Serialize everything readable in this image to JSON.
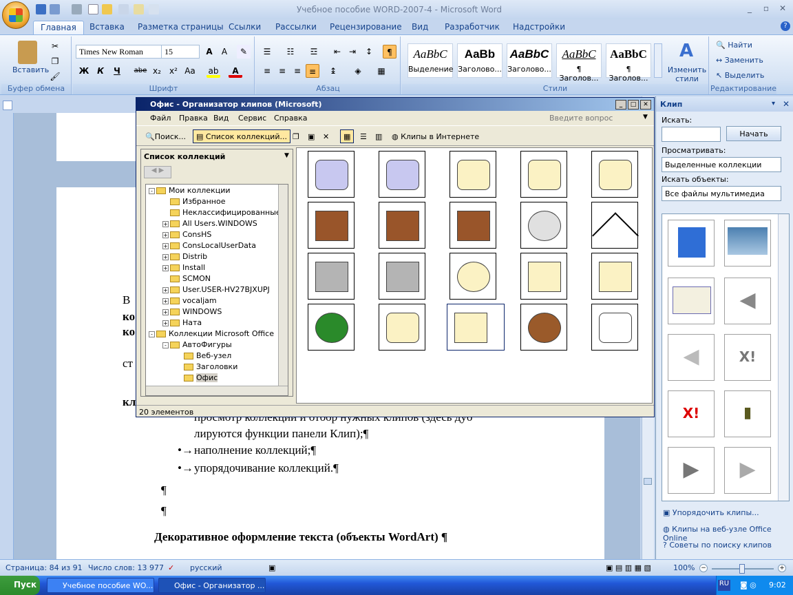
{
  "window": {
    "title": "Учебное пособие WORD-2007-4 - Microsoft Word"
  },
  "tabs": [
    "Главная",
    "Вставка",
    "Разметка страницы",
    "Ссылки",
    "Рассылки",
    "Рецензирование",
    "Вид",
    "Разработчик",
    "Надстройки"
  ],
  "ribbon": {
    "clipboard": {
      "paste_label": "Вставить",
      "group_label": "Буфер обмена"
    },
    "font": {
      "name": "Times New Roman",
      "size": "15",
      "group_label": "Шрифт",
      "bold": "Ж",
      "italic": "К",
      "underline": "Ч",
      "strike": "abe"
    },
    "paragraph": {
      "group_label": "Абзац"
    },
    "styles": {
      "group_label": "Стили",
      "items": [
        {
          "sample": "AaBbC",
          "name": "Выделение"
        },
        {
          "sample": "AaBb",
          "name": "Заголово..."
        },
        {
          "sample": "AaBbC",
          "name": "Заголово..."
        },
        {
          "sample": "AaBbC",
          "name": "¶ Заголов..."
        },
        {
          "sample": "AaBbC",
          "name": "¶ Заголов..."
        }
      ],
      "change_label": "Изменить стили"
    },
    "editing": {
      "group_label": "Редактирование",
      "find": "Найти",
      "replace": "Заменить",
      "select": "Выделить"
    }
  },
  "document": {
    "lines": [
      {
        "text": "В",
        "bold": false
      },
      {
        "text": "ко",
        "bold": true
      },
      {
        "text": "ко",
        "bold": true
      },
      {
        "text": "ст",
        "bold": false
      },
      {
        "text": "кл",
        "bold": true
      },
      {
        "text": "просмотр коллекций и отбор нужных клипов (здесь дуб",
        "bold": false
      },
      {
        "text": "лируются функции панели Клип);¶",
        "bold": false
      },
      {
        "text": "наполнение коллекций;¶",
        "bold": false
      },
      {
        "text": "упорядочивание коллекций.¶",
        "bold": false
      },
      {
        "text": "¶",
        "bold": false
      },
      {
        "text": "¶",
        "bold": false
      },
      {
        "text": "Декоративное оформление текста (объекты WordArt) ¶",
        "bold": true
      }
    ],
    "bullet": "•→"
  },
  "organizer": {
    "title": "Офис - Организатор клипов (Microsoft)",
    "menu": [
      "Файл",
      "Правка",
      "Вид",
      "Сервис",
      "Справка"
    ],
    "help_placeholder": "Введите вопрос",
    "toolbar": {
      "search": "Поиск...",
      "collections": "Список коллекций...",
      "online": "Клипы в Интернете"
    },
    "left_title": "Список коллекций",
    "tree": [
      {
        "label": "Мои коллекции",
        "level": 0,
        "toggle": "-"
      },
      {
        "label": "Избранное",
        "level": 1,
        "toggle": ""
      },
      {
        "label": "Неклассифицированные к",
        "level": 1,
        "toggle": ""
      },
      {
        "label": "All Users.WINDOWS",
        "level": 1,
        "toggle": "+"
      },
      {
        "label": "ConsHS",
        "level": 1,
        "toggle": "+"
      },
      {
        "label": "ConsLocalUserData",
        "level": 1,
        "toggle": "+"
      },
      {
        "label": "Distrib",
        "level": 1,
        "toggle": "+"
      },
      {
        "label": "Install",
        "level": 1,
        "toggle": "+"
      },
      {
        "label": "SCMON",
        "level": 1,
        "toggle": ""
      },
      {
        "label": "User.USER-HV27BJXUPJ",
        "level": 1,
        "toggle": "+"
      },
      {
        "label": "vocaljam",
        "level": 1,
        "toggle": "+"
      },
      {
        "label": "WINDOWS",
        "level": 1,
        "toggle": "+"
      },
      {
        "label": "Ната",
        "level": 1,
        "toggle": "+"
      },
      {
        "label": "Коллекции Microsoft Office",
        "level": 0,
        "toggle": "-"
      },
      {
        "label": "АвтоФигуры",
        "level": 1,
        "toggle": "-"
      },
      {
        "label": "Веб-узел",
        "level": 2,
        "toggle": ""
      },
      {
        "label": "Заголовки",
        "level": 2,
        "toggle": ""
      },
      {
        "label": "Офис",
        "level": 2,
        "toggle": ""
      }
    ],
    "status": "20 элементов"
  },
  "clip_pane": {
    "title": "Клип",
    "search_label": "Искать:",
    "start_button": "Начать",
    "browse_label": "Просматривать:",
    "browse_value": "Выделенные коллекции",
    "types_label": "Искать объекты:",
    "types_value": "Все файлы мультимедиа",
    "links": [
      "Упорядочить клипы...",
      "Клипы на веб-узле Office Online",
      "Советы по поиску клипов"
    ]
  },
  "status": {
    "page": "Страница: 84 из 91",
    "words": "Число слов: 13 977",
    "lang": "русский",
    "zoom": "100%"
  },
  "taskbar": {
    "start": "Пуск",
    "tasks": [
      "Учебное пособие WO...",
      "Офис - Организатор ..."
    ],
    "lang": "RU",
    "time": "9:02"
  },
  "colors": {
    "ribbon_accent": "#15428b",
    "title_active": "#0a246a",
    "taskbar": "#2157d7"
  }
}
